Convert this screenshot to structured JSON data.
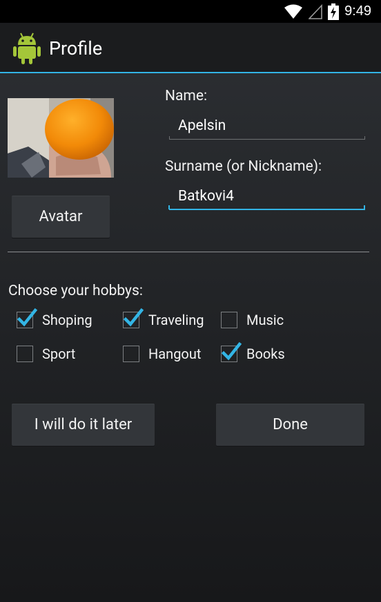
{
  "status_bar": {
    "time": "9:49"
  },
  "app_bar": {
    "title": "Profile"
  },
  "profile": {
    "avatar_button": "Avatar",
    "name_label": "Name:",
    "name_value": "Apelsin",
    "surname_label": "Surname (or Nickname):",
    "surname_value": "Batkovi4"
  },
  "hobbies": {
    "label": "Choose your hobbys:",
    "items": [
      {
        "label": "Shoping",
        "checked": true
      },
      {
        "label": "Traveling",
        "checked": true
      },
      {
        "label": "Music",
        "checked": false
      },
      {
        "label": "Sport",
        "checked": false
      },
      {
        "label": "Hangout",
        "checked": false
      },
      {
        "label": "Books",
        "checked": true
      }
    ]
  },
  "actions": {
    "later": "I will do it later",
    "done": "Done"
  },
  "colors": {
    "accent": "#33b5e5",
    "action_bar": "#1b1c1e",
    "button": "#33363a"
  }
}
